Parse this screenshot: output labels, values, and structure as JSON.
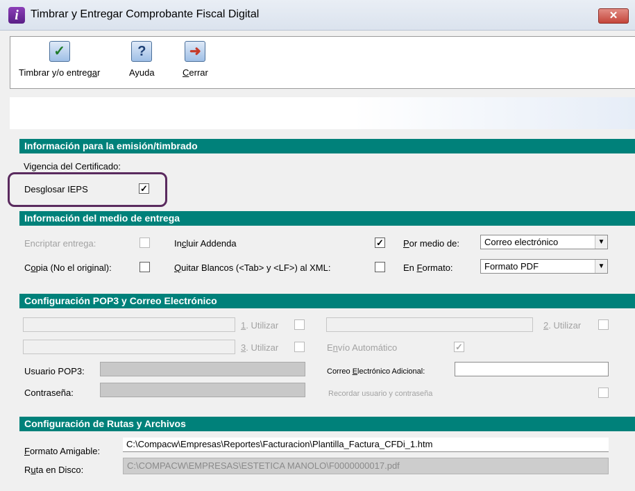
{
  "window": {
    "title": "Timbrar y Entregar Comprobante Fiscal Digital",
    "app_icon_glyph": "i",
    "close_glyph": "✕"
  },
  "toolbar": {
    "timbrar_label": "Timbrar y/o entregar",
    "ayuda_label": "Ayuda",
    "cerrar_label": "Cerrar",
    "timbrar_icon": "check-icon",
    "ayuda_icon": "help-icon",
    "cerrar_icon": "exit-icon"
  },
  "emision": {
    "header": "Información para la emisión/timbrado",
    "vigencia_label": "Vigencia del Certificado:",
    "desglosar_label": "Desglosar IEPS",
    "desglosar_checked": true
  },
  "entrega": {
    "header": "Información del medio de entrega",
    "encriptar_label": "Encriptar entrega:",
    "incluir_label": "Incluir Addenda",
    "incluir_checked": true,
    "por_medio_label": "Por medio de:",
    "por_medio_value": "Correo electrónico",
    "copia_label": "Copia (No el original):",
    "quitar_label": "Quitar Blancos (<Tab> y <LF>) al  XML:",
    "en_formato_label": "En Formato:",
    "en_formato_value": "Formato PDF"
  },
  "pop3": {
    "header": "Configuración POP3 y Correo Electrónico",
    "utilizar1": "1. Utilizar",
    "utilizar2": "2. Utilizar",
    "utilizar3": "3. Utilizar",
    "envio_label": "Envío Automático",
    "envio_checked": true,
    "usuario_label": "Usuario POP3:",
    "contrasena_label": "Contraseña:",
    "correo_adicional_label": "Correo Electrónico Adicional:",
    "recordar_label": "Recordar usuario y contraseña"
  },
  "rutas": {
    "header": "Configuración de Rutas y Archivos",
    "formato_label": "Formato Amigable:",
    "formato_value": "C:\\Compacw\\Empresas\\Reportes\\Facturacion\\Plantilla_Factura_CFDi_1.htm",
    "ruta_label": "Ruta en Disco:",
    "ruta_value": "C:\\COMPACW\\EMPRESAS\\ESTETICA MANOLO\\F0000000017.pdf"
  },
  "colors": {
    "section_header": "#00817a",
    "highlight_border": "#5a2a5e"
  }
}
